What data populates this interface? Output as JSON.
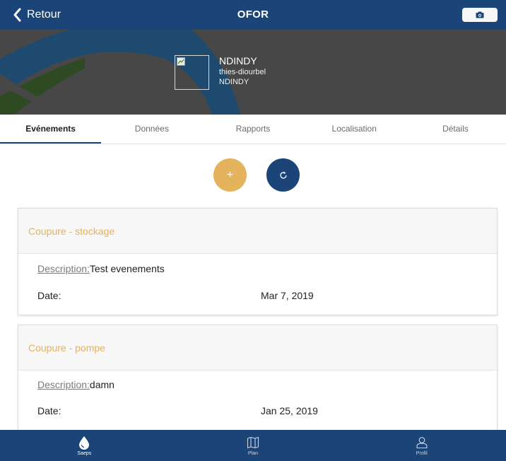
{
  "navbar": {
    "back_label": "Retour",
    "title": "OFOR",
    "camera_icon": "camera-icon"
  },
  "banner": {
    "name": "NDINDY",
    "region": "thies-diourbel",
    "site": "NDINDY"
  },
  "tabs": [
    {
      "label": "Evénements",
      "active": true
    },
    {
      "label": "Données",
      "active": false
    },
    {
      "label": "Rapports",
      "active": false
    },
    {
      "label": "Localisation",
      "active": false
    },
    {
      "label": "Détails",
      "active": false
    }
  ],
  "actions": {
    "add_label": "+",
    "refresh_icon": "refresh-icon"
  },
  "events": [
    {
      "title": "Coupure - stockage",
      "description_label": "Description:",
      "description": "Test evenements",
      "date_label": "Date:",
      "date": "Mar 7, 2019"
    },
    {
      "title": "Coupure - pompe",
      "description_label": "Description:",
      "description": "damn",
      "date_label": "Date:",
      "date": "Jan 25, 2019"
    }
  ],
  "bottom_tabs": [
    {
      "label": "Saeps",
      "icon": "water-drop-icon",
      "active": true
    },
    {
      "label": "Plan",
      "icon": "map-icon",
      "active": false
    },
    {
      "label": "Profil",
      "icon": "user-icon",
      "active": false
    }
  ],
  "colors": {
    "primary": "#1b4578",
    "accent": "#e5b25e",
    "banner_bg": "#474747"
  }
}
